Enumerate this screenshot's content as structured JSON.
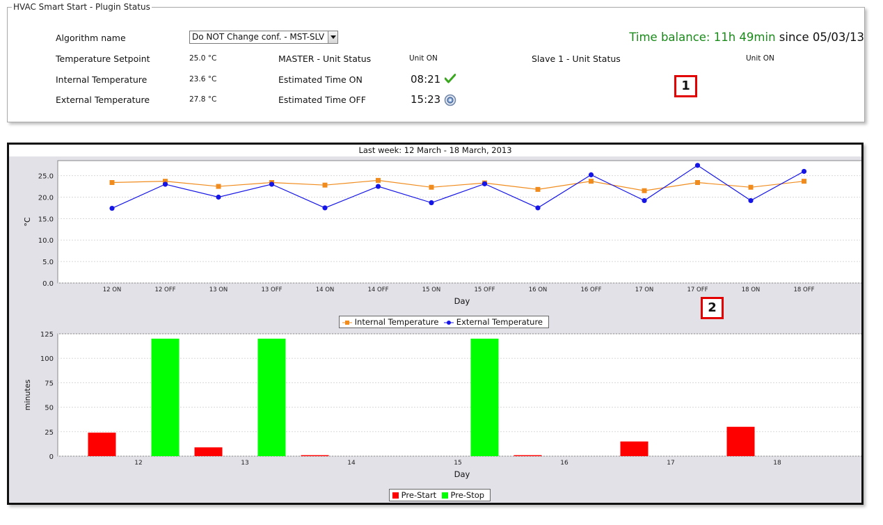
{
  "status": {
    "legend": "HVAC Smart Start - Plugin Status",
    "algorithm_label": "Algorithm name",
    "algorithm_value": "Do NOT Change conf. - MST-SLV",
    "time_balance_label": "Time balance: 11h 49min",
    "time_balance_since": " since 05/03/13",
    "rows": {
      "setpoint_label": "Temperature Setpoint",
      "setpoint_value": "25.0 °C",
      "internal_label": "Internal Temperature",
      "internal_value": "23.6 °C",
      "external_label": "External Temperature",
      "external_value": "27.8 °C",
      "master_label": "MASTER - Unit Status",
      "master_value": "Unit ON",
      "est_on_label": "Estimated Time ON",
      "est_on_value": "08:21",
      "est_off_label": "Estimated Time OFF",
      "est_off_value": "15:23",
      "slave_label": "Slave 1 - Unit Status",
      "slave_value": "Unit ON"
    },
    "badge1": "1",
    "badge2": "2",
    "icons": {
      "check": "check-icon",
      "pending": "pending-icon"
    },
    "colors": {
      "time_balance": "#1a8a1a",
      "badge_border": "#e30000"
    }
  },
  "chart_data": [
    {
      "type": "line",
      "title": "Last week: 12 March - 18 March, 2013",
      "xlabel": "Day",
      "ylabel": "°C",
      "categories": [
        "12 ON",
        "12 OFF",
        "13 ON",
        "13 OFF",
        "14 ON",
        "14 OFF",
        "15 ON",
        "15 OFF",
        "16 ON",
        "16 OFF",
        "17 ON",
        "17 OFF",
        "18 ON",
        "18 OFF"
      ],
      "ylim": [
        0,
        28.5
      ],
      "yticks": [
        "0.0",
        "5.0",
        "10.0",
        "15.0",
        "20.0",
        "25.0"
      ],
      "grid": true,
      "legend_position": "bottom",
      "series": [
        {
          "name": "Internal Temperature",
          "color": "#f08c1e",
          "marker": "square",
          "values": [
            23.4,
            23.7,
            22.5,
            23.4,
            22.8,
            23.9,
            22.3,
            23.3,
            21.8,
            23.7,
            21.5,
            23.4,
            22.3,
            23.7
          ]
        },
        {
          "name": "External Temperature",
          "color": "#1515e6",
          "marker": "circle",
          "values": [
            17.4,
            23.0,
            20.0,
            23.0,
            17.5,
            22.5,
            18.7,
            23.1,
            17.5,
            25.2,
            19.2,
            27.4,
            19.2,
            26.0
          ]
        }
      ]
    },
    {
      "type": "bar",
      "xlabel": "Day",
      "ylabel": "minutes",
      "categories": [
        "12",
        "13",
        "14",
        "15",
        "16",
        "17",
        "18"
      ],
      "ylim": [
        0,
        125
      ],
      "yticks": [
        "0",
        "25",
        "50",
        "75",
        "100",
        "125"
      ],
      "grid": true,
      "legend_position": "bottom",
      "series": [
        {
          "name": "Pre-Start",
          "color": "#ff0000",
          "values": [
            24,
            9,
            1,
            0,
            1,
            15,
            30
          ]
        },
        {
          "name": "Pre-Stop",
          "color": "#00ff00",
          "values": [
            120,
            120,
            0,
            120,
            0,
            0,
            0
          ]
        }
      ]
    }
  ]
}
